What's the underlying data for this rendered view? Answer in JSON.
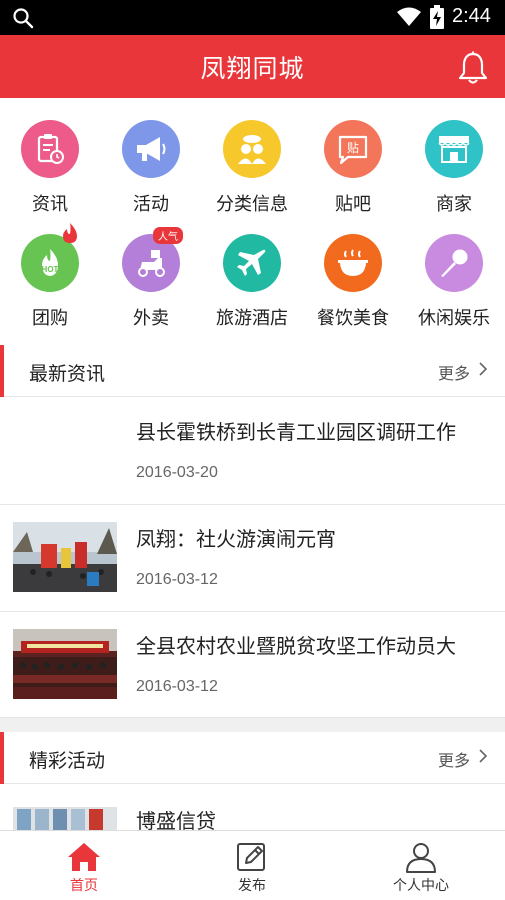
{
  "status_bar": {
    "time": "2:44",
    "icons": [
      "search-icon",
      "wifi-icon",
      "battery-charging-icon"
    ]
  },
  "app_bar": {
    "title": "凤翔同城",
    "right_icon": "bell-icon"
  },
  "categories": [
    {
      "label": "资讯",
      "icon": "news-clipboard-icon",
      "color": "#ec5b8a"
    },
    {
      "label": "活动",
      "icon": "megaphone-icon",
      "color": "#7f97e8"
    },
    {
      "label": "分类信息",
      "icon": "people-icon",
      "color": "#f6c82b"
    },
    {
      "label": "贴吧",
      "icon": "chat-bubble-icon",
      "color": "#f4765a"
    },
    {
      "label": "商家",
      "icon": "storefront-icon",
      "color": "#2fc2c6"
    },
    {
      "label": "团购",
      "icon": "hot-icon",
      "color": "#67c452",
      "hot": true
    },
    {
      "label": "外卖",
      "icon": "scooter-icon",
      "color": "#b47fd8",
      "badge": "人气"
    },
    {
      "label": "旅游酒店",
      "icon": "airplane-icon",
      "color": "#22b9a2"
    },
    {
      "label": "餐饮美食",
      "icon": "bowl-icon",
      "color": "#f26a1e"
    },
    {
      "label": "休闲娱乐",
      "icon": "microphone-icon",
      "color": "#c98be0"
    }
  ],
  "news_section": {
    "title": "最新资讯",
    "more": "更多",
    "items": [
      {
        "title": "县长霍铁桥到长青工业园区调研工作",
        "date": "2016-03-20",
        "has_image": false
      },
      {
        "title": "凤翔：社火游演闹元宵",
        "date": "2016-03-12",
        "has_image": true
      },
      {
        "title": "全县农村农业暨脱贫攻坚工作动员大",
        "date": "2016-03-12",
        "has_image": true
      }
    ]
  },
  "activity_section": {
    "title": "精彩活动",
    "more": "更多",
    "items": [
      {
        "title": "博盛信贷"
      }
    ]
  },
  "tab_bar": {
    "tabs": [
      {
        "label": "首页",
        "icon": "home-icon",
        "active": true
      },
      {
        "label": "发布",
        "icon": "edit-icon",
        "active": false
      },
      {
        "label": "个人中心",
        "icon": "person-icon",
        "active": false
      }
    ]
  },
  "colors": {
    "primary": "#e8363a",
    "background": "#ffffff",
    "divider": "#e6e6e6"
  }
}
